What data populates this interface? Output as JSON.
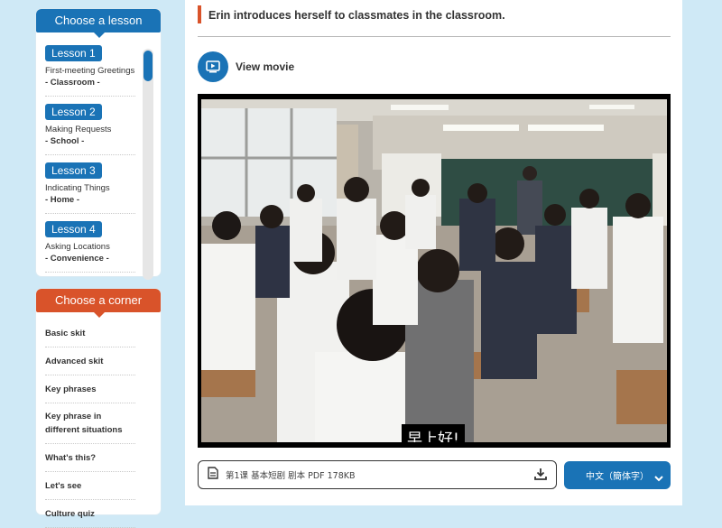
{
  "lesson_panel": {
    "title": "Choose a lesson",
    "items": [
      {
        "badge": "Lesson 1",
        "title": "First-meeting Greetings",
        "sub": "- Classroom -"
      },
      {
        "badge": "Lesson 2",
        "title": "Making Requests",
        "sub": "- School -"
      },
      {
        "badge": "Lesson 3",
        "title": "Indicating Things",
        "sub": "- Home -"
      },
      {
        "badge": "Lesson 4",
        "title": "Asking Locations",
        "sub": "- Convenience -"
      }
    ]
  },
  "corner_panel": {
    "title": "Choose a corner",
    "items": [
      "Basic skit",
      "Advanced skit",
      "Key phrases",
      "Key phrase in different situations",
      "What's this?",
      "Let's see",
      "Culture quiz"
    ]
  },
  "main": {
    "scene_title": "Erin introduces herself to classmates in the classroom.",
    "view_movie": "View movie",
    "subtitle": "早上好!",
    "download_label": "第1课 基本短剧  剧本 PDF  178KB",
    "language": "中文（簡体字）"
  },
  "colors": {
    "lesson_blue": "#1a73b6",
    "corner_orange": "#d9532a",
    "background": "#cfe9f6"
  },
  "icons": [
    "movie-icon",
    "document-icon",
    "download-icon",
    "chevron-down-icon"
  ]
}
